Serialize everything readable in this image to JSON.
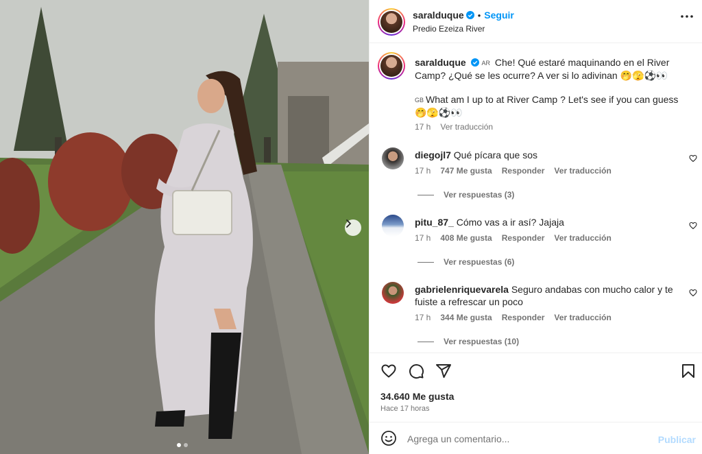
{
  "post": {
    "username": "saralduque",
    "follow_label": "Seguir",
    "location": "Predio Ezeiza River",
    "image_count": 2,
    "active_image": 1
  },
  "caption": {
    "username": "saralduque",
    "flag_ar": "AR",
    "text_es": "Che! Qué estaré maquinando en el River Camp? ¿Qué se les ocurre? A ver si lo adivinan 🤭🫣⚽👀",
    "flag_gb": "GB",
    "text_en": "What am I up to at River Camp ? Let's see if you can guess 🤭🫣⚽👀",
    "time": "17 h",
    "translate": "Ver traducción"
  },
  "comments": [
    {
      "username": "diegojl7",
      "text": "Qué pícara que sos",
      "time": "17 h",
      "likes": "747 Me gusta",
      "reply": "Responder",
      "translate": "Ver traducción",
      "view_replies": "Ver respuestas (3)"
    },
    {
      "username": "pitu_87_",
      "text": "Cómo vas a ir así? Jajaja",
      "time": "17 h",
      "likes": "408 Me gusta",
      "reply": "Responder",
      "translate": "Ver traducción",
      "view_replies": "Ver respuestas (6)"
    },
    {
      "username": "gabrielenriquevarela",
      "text": "Seguro andabas con mucho calor y te fuiste a refrescar un poco",
      "time": "17 h",
      "likes": "344 Me gusta",
      "reply": "Responder",
      "translate": "Ver traducción",
      "view_replies": "Ver respuestas (10)"
    }
  ],
  "stats": {
    "likes": "34.640 Me gusta",
    "time": "Hace 17 horas"
  },
  "composer": {
    "placeholder": "Agrega un comentario...",
    "publish_label": "Publicar"
  },
  "icons": {
    "like": "heart-icon",
    "comment": "comment-icon",
    "share": "share-icon",
    "save": "bookmark-icon",
    "emoji": "emoji-icon",
    "more": "more-icon",
    "next": "chevron-right-icon",
    "verified": "verified-badge-icon"
  },
  "colors": {
    "accent": "#0095f6",
    "verified": "#0095f6",
    "publish_disabled": "#b3dbff"
  }
}
